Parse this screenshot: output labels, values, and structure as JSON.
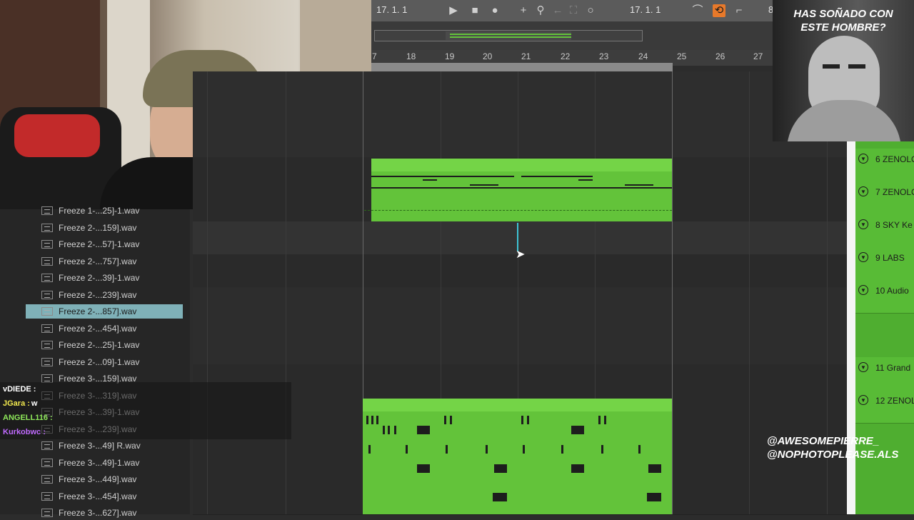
{
  "transport": {
    "position_left": "17.   1.   1",
    "position_right": "17.   1.   1",
    "clipped_digit": "8"
  },
  "ruler": {
    "bars": [
      "7",
      "18",
      "19",
      "20",
      "21",
      "22",
      "23",
      "24",
      "25",
      "26",
      "27"
    ]
  },
  "browser": {
    "selected_index": 6,
    "files": [
      "Freeze 1-...25]-1.wav",
      "Freeze 2-...159].wav",
      "Freeze 2-...57]-1.wav",
      "Freeze 2-...757].wav",
      "Freeze 2-...39]-1.wav",
      "Freeze 2-...239].wav",
      "Freeze 2-...857].wav",
      "Freeze 2-...454].wav",
      "Freeze 2-...25]-1.wav",
      "Freeze 2-...09]-1.wav",
      "Freeze 3-...159].wav",
      "Freeze 3-...319].wav",
      "Freeze 3-...39]-1.wav",
      "Freeze 3-...239].wav",
      "Freeze 3-...49] R.wav",
      "Freeze 3-...49]-1.wav",
      "Freeze 3-...449].wav",
      "Freeze 3-...454].wav",
      "Freeze 3-...627].wav"
    ]
  },
  "mixer": {
    "tracks": [
      "6 ZENOLO",
      "7 ZENOLO",
      "8 SKY Ke",
      "9 LABS",
      "10 Audio",
      "11 Grand",
      "12 ZENOL"
    ]
  },
  "overlay": {
    "meme_text_line1": "HAS SOÑADO CON",
    "meme_text_line2": "ESTE HOMBRE?",
    "handle1": "@AWESOMEPIERRE_",
    "handle2": "@NOPHOTOPLEASE.ALS"
  },
  "chat": [
    {
      "user": "vDIEDE :",
      "message": "",
      "color": "#ffffff"
    },
    {
      "user": "JGara :",
      "message": "w",
      "color": "#f2e94e"
    },
    {
      "user": "ANGELL116 :",
      "message": "",
      "color": "#8ee85a"
    },
    {
      "user": "Kurkobwc :",
      "message": "",
      "color": "#c06bff"
    }
  ],
  "colors": {
    "clip_green": "#63c33a",
    "selection": "#7fb1b8",
    "mixer_green": "#58bb36"
  }
}
